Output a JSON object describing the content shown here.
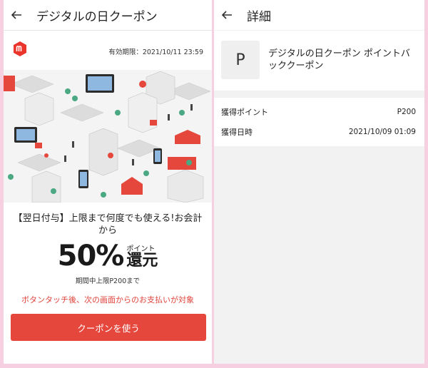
{
  "left": {
    "title": "デジタルの日クーポン",
    "expiry": "有効期限：2021/10/11 23:59",
    "headline": "【翌日付与】上限まで何度でも使える!お会計から",
    "percent": "50%",
    "point_label": "ポイント",
    "return_label": "還元",
    "limit": "期間中上限P200まで",
    "notice": "ボタンタッチ後、次の画面からのお支払いが対象",
    "button": "クーポンを使う",
    "colors": {
      "accent": "#e5473d",
      "notice": "#e0423a",
      "logo": "#ea352d"
    }
  },
  "right": {
    "title": "詳細",
    "icon_letter": "P",
    "coupon_name": "デジタルの日クーポン ポイントバッククーポン",
    "rows": [
      {
        "label": "獲得ポイント",
        "value": "P200"
      },
      {
        "label": "獲得日時",
        "value": "2021/10/09 01:09"
      }
    ]
  },
  "icons": [
    "back-arrow-icon",
    "mercari-logo-icon",
    "city-illustration"
  ]
}
